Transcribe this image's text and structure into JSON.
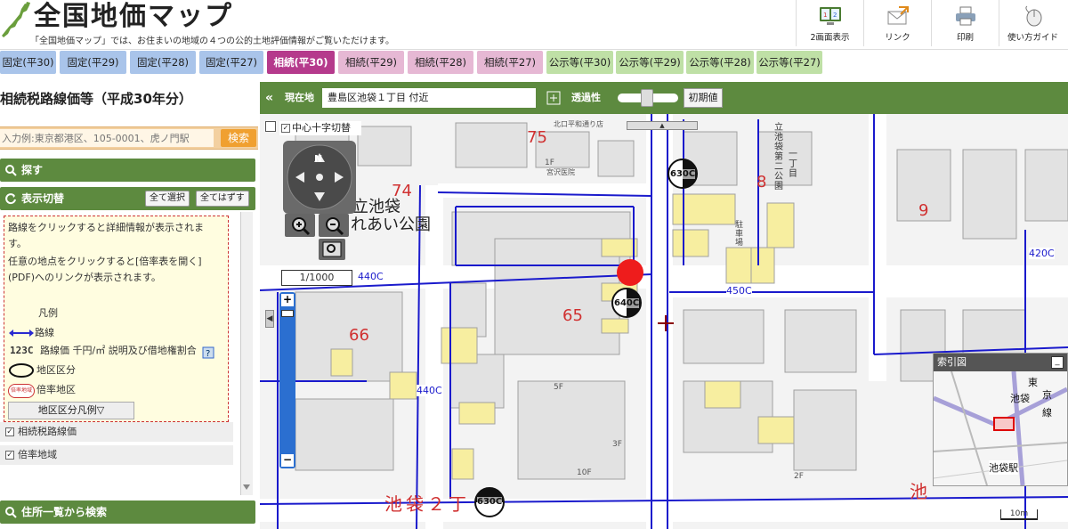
{
  "header": {
    "title": "全国地価マップ",
    "tagline": "「全国地価マップ」では、お住まいの地域の４つの公的土地評価情報がご覧いただけます。",
    "buttons": [
      {
        "label": "2画面表示",
        "icon": "dual-screen-icon"
      },
      {
        "label": "リンク",
        "icon": "mail-link-icon"
      },
      {
        "label": "印刷",
        "icon": "printer-icon"
      },
      {
        "label": "使い方ガイド",
        "icon": "mouse-icon"
      }
    ]
  },
  "tabs": [
    {
      "label": "固定(平30)",
      "kind": "fixed"
    },
    {
      "label": "固定(平29)",
      "kind": "fixed"
    },
    {
      "label": "固定(平28)",
      "kind": "fixed"
    },
    {
      "label": "固定(平27)",
      "kind": "fixed"
    },
    {
      "label": "相続(平30)",
      "kind": "inh",
      "active": true
    },
    {
      "label": "相続(平29)",
      "kind": "inh"
    },
    {
      "label": "相続(平28)",
      "kind": "inh"
    },
    {
      "label": "相続(平27)",
      "kind": "inh"
    },
    {
      "label": "公示等(平30)",
      "kind": "pub"
    },
    {
      "label": "公示等(平29)",
      "kind": "pub"
    },
    {
      "label": "公示等(平28)",
      "kind": "pub"
    },
    {
      "label": "公示等(平27)",
      "kind": "pub"
    }
  ],
  "panel": {
    "title": "相続税路線価等（平成30年分）",
    "search_placeholder": "入力例:東京都港区、105-0001、虎ノ門駅",
    "search_button": "検索",
    "find_section": "探す",
    "display_section": "表示切替",
    "select_all": "全て選択",
    "deselect_all": "全てはずす",
    "info_line1": "路線をクリックすると詳細情報が表示されま",
    "info_line2": "す。",
    "info_line3": "任意の地点をクリックすると[倍率表を開く]",
    "info_line4": "(PDF)へのリンクが表示されます。",
    "legend_title": "凡例",
    "legend_route": "路線",
    "legend_price_code": "123C",
    "legend_price": "路線価 千円/㎡ 説明及び借地権割合",
    "legend_district": "地区区分",
    "legend_ratio_badge": "倍率地域",
    "legend_ratio": "倍率地区",
    "district_legend_button": "地区区分凡例▽",
    "check_route_price": "相続税路線価",
    "check_ratio_area": "倍率地域",
    "address_section": "住所一覧から検索"
  },
  "map_toolbar": {
    "current_label": "現在地",
    "current_location": "豊島区池袋１丁目 付近",
    "transparency_label": "透過性",
    "transparency": 0.5,
    "reset_button": "初期値",
    "crosshair_toggle": "中心十字切替",
    "scale": "1/1000",
    "compass": "N"
  },
  "map": {
    "blocks": [
      "75",
      "74",
      "8",
      "9",
      "65",
      "66"
    ],
    "route_prices": [
      "440C",
      "450C",
      "420C",
      "440C"
    ],
    "circle_prices": [
      "630C",
      "640C",
      "630C"
    ],
    "park_name_1": "立池袋",
    "park_name_2": "れあい公園",
    "area_name": "池袋２丁",
    "parking": "駐車場",
    "labels_small": [
      "5F",
      "3F",
      "2F",
      "1F",
      "10F"
    ],
    "park_vertical": "立池袋第二公園",
    "address_vertical": "一丁目",
    "street_small": "北口平和通り店",
    "hospital": "宮沢医院",
    "red_right": "池"
  },
  "minimap": {
    "title": "索引図",
    "station": "池袋駅",
    "scalebar": "10m",
    "kanji": [
      "東",
      "京",
      "線",
      "池袋"
    ]
  }
}
